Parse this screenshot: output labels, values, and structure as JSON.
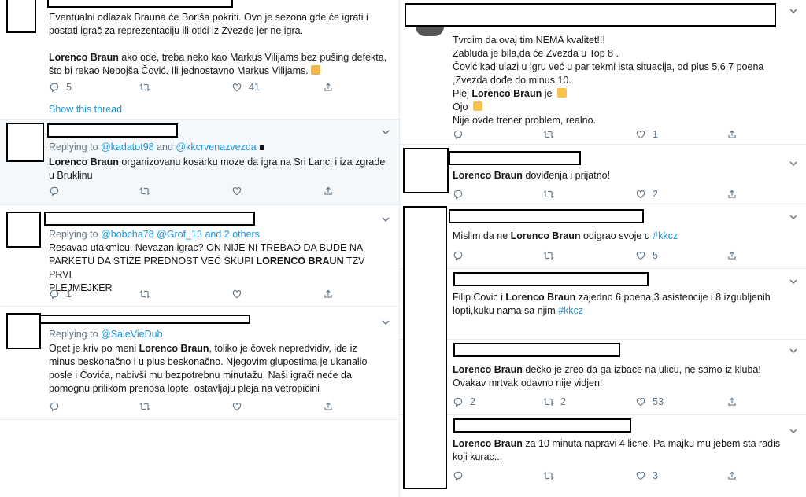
{
  "left": {
    "t1": {
      "line1": "Eventualni odlazak Brauna će Boriša pokriti. Ovo je sezona gde će igrati i",
      "line2": "postati igrač za reprezentaciju ili otići iz Zvezde jer ne igra.",
      "p2_name": "Lorenco Braun",
      "p2_a": " ako ode, treba neko kao Markus Vilijams bez pušing defekta,",
      "p2_b": "što bi rekao Nebojša Čović. Ili jednostavno Markus Vilijams.",
      "replies": "5",
      "likes": "41",
      "show_thread": "Show this thread"
    },
    "t2": {
      "replying": "Replying to ",
      "mention1": "@kadatot98",
      "and": " and ",
      "mention2": "@kkcrvenazvezda",
      "name": "Lorenco Braun",
      "a": " organizovanu kosarku moze da igra na Sri Lanci i iza zgrade",
      "b": "u Bruklinu"
    },
    "t3": {
      "replying": "Replying to ",
      "mention1": "@bobcha78",
      "mention2": "@Grof_13",
      "others": " and 2 others",
      "l1": "Resavao utakmicu. Nevazan igrac? ON NIJE NI TREBAO DA BUDE NA",
      "l2": "PARKETU DA STIŽE PREDNOST VEĆ SKUPI ",
      "name": "LORENCO BRAUN",
      "l2b": " TZV PRVI",
      "l3": "PLEJMEJKER",
      "replies": "1"
    },
    "t4": {
      "replying": "Replying to ",
      "mention1": "@SaleVieDub",
      "l1a": "Opet je kriv po meni ",
      "name": "Lorenco Braun",
      "l1b": ", toliko je čovek nepredvidiv, ide iz",
      "l2": "minus beskonačno i u plus beskonačno. Njegovim glupostima je ukanalio",
      "l3": "posle i Čovića, nabivši mu bezpotrebnu minutažu. Naši igrači neće da",
      "l4": "pomognu prilikom prenosa lopte, ostavljaju pleja na vetropičini"
    }
  },
  "right": {
    "r1": {
      "l1": "Tvrdim da ovaj tim NEMA kvalitet!!!",
      "l2": "Zabluda je bila,da će Zvezda u Top 8 .",
      "l3": "Čović kad ulazi u igru već u par tekmi ista situacija, od plus 5,6,7 poena",
      "l4": ",Zvezda dođe do minus 10.",
      "l5a": "Plej ",
      "name": "Lorenco Braun",
      "l5b": " je ",
      "l6": "Ojo ",
      "l7": "Nije ovde trener problem, realno.",
      "likes": "1"
    },
    "r2": {
      "name": "Lorenco Braun",
      "rest": " doviđenja i prijatno!",
      "likes": "2"
    },
    "r3": {
      "a": "Mislim da ne ",
      "name": "Lorenco Braun",
      "b": " odigrao svoje u ",
      "tag": "#kkcz",
      "likes": "5"
    },
    "r4": {
      "a": "Filip Covic i ",
      "name": "Lorenco Braun",
      "b": " zajedno 6 poena,3 asistencije i 8 izgubljenih",
      "c": "lopti,kuku nama sa njim ",
      "tag": "#kkcz"
    },
    "r5": {
      "name": "Lorenco Braun",
      "a": " dečko je zreo da ga izbace na ulicu, ne samo iz kluba!",
      "b": "Ovakav mrtvak odavno nije vidjen!",
      "replies": "2",
      "retweets": "2",
      "likes": "53"
    },
    "r6": {
      "name": "Lorenco Braun",
      "a": " za 10 minuta napravi 4 licne. Pa majku mu jebem sta radis",
      "b": "koji kurac...",
      "likes": "3"
    }
  },
  "colors": {
    "link": "#1b95e0",
    "muted": "#657786",
    "highlight_bg": "#f5f8fa",
    "border": "#e6ecf0"
  },
  "icons": [
    "reply-icon",
    "retweet-icon",
    "like-icon",
    "share-icon",
    "chevron-down-icon"
  ]
}
